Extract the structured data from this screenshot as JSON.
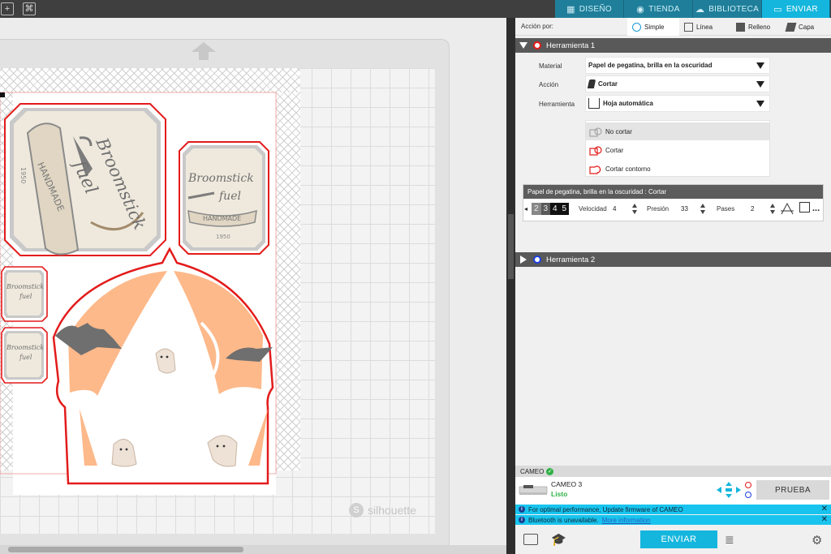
{
  "topbar": {
    "tabs": [
      {
        "label": "DISEÑO",
        "icon": "grid-icon"
      },
      {
        "label": "TIENDA",
        "icon": "shop-icon"
      },
      {
        "label": "BIBLIOTECA",
        "icon": "cloud-icon"
      },
      {
        "label": "ENVIAR",
        "icon": "cameo-icon"
      }
    ],
    "active_tab": "ENVIAR"
  },
  "canvas": {
    "watermark": "silhouette",
    "design_text": {
      "line1": "Broomstick",
      "line2": "fuel",
      "banner": "HANDMADE",
      "year": "1950"
    }
  },
  "panel": {
    "action_label": "Acción por:",
    "action_tabs": [
      "Simple",
      "Línea",
      "Relleno",
      "Capa"
    ],
    "active_action": "Simple",
    "tool1": {
      "title": "Herramienta 1",
      "color": "#e31b1b",
      "material_label": "Material",
      "material_value": "Papel de pegatina, brilla en la oscuridad",
      "action_label": "Acción",
      "action_value": "Cortar",
      "tool_label": "Herramienta",
      "tool_value": "Hoja automática",
      "cut_options": [
        "No cortar",
        "Cortar",
        "Cortar contorno"
      ],
      "selected_cut": "No cortar",
      "settings_header": "Papel de pegatina, brilla en la oscuridad : Cortar",
      "blade_digits": [
        "2",
        "3",
        "4",
        "5"
      ],
      "speed_label": "Velocidad",
      "speed": "4",
      "pressure_label": "Presión",
      "pressure": "33",
      "passes_label": "Pases",
      "passes": "2",
      "more": "..."
    },
    "tool2": {
      "title": "Herramienta 2",
      "color": "#1b3fe3"
    },
    "machine": {
      "section": "CAMEO",
      "name": "CAMEO 3",
      "status": "Listo",
      "test_label": "PRUEBA"
    },
    "notices": [
      {
        "text": "For optimal performance, Update firmware of CAMEO",
        "link": ""
      },
      {
        "text": "Bluetooth is unavailable.",
        "link": "More information"
      }
    ],
    "send_label": "ENVIAR"
  }
}
